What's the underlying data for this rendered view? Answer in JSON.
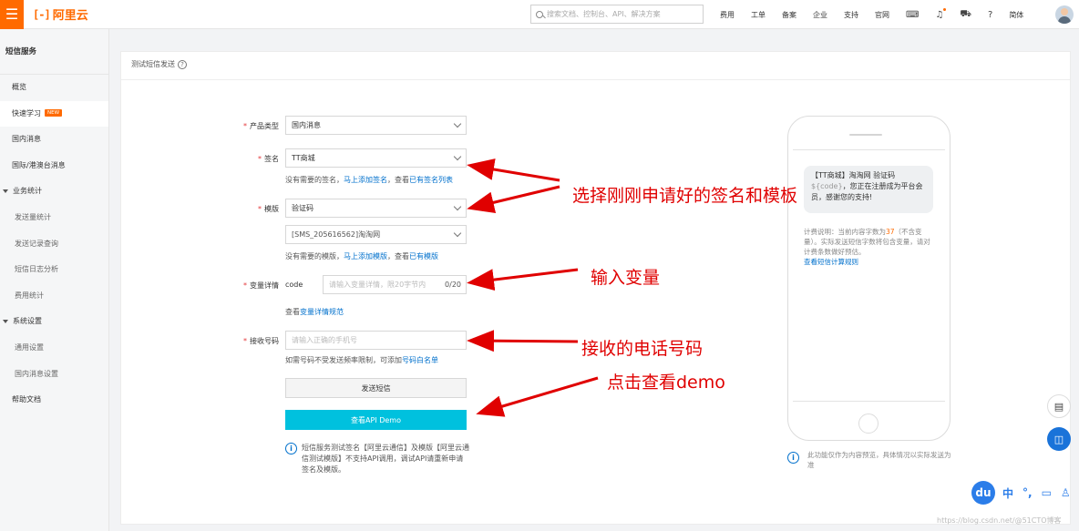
{
  "topbar": {
    "menu_icon": "hamburger-icon",
    "logo_mark": "[-]",
    "logo_text": "阿里云",
    "search_placeholder": "搜索文档、控制台、API、解决方案",
    "nav": [
      "费用",
      "工单",
      "备案",
      "企业",
      "支持",
      "官网"
    ],
    "language": "简体",
    "icons": [
      "terminal-icon",
      "bell-icon",
      "cart-icon",
      "help-icon"
    ]
  },
  "sidebar": {
    "title": "短信服务",
    "items": [
      {
        "label": "概览"
      },
      {
        "label": "快速学习",
        "badge": "NEW"
      },
      {
        "label": "国内消息"
      },
      {
        "label": "国际/港澳台消息"
      },
      {
        "label": "业务统计"
      },
      {
        "label": "发送量统计"
      },
      {
        "label": "发送记录查询"
      },
      {
        "label": "短信日志分析"
      },
      {
        "label": "费用统计"
      },
      {
        "label": "系统设置"
      },
      {
        "label": "通用设置"
      },
      {
        "label": "国内消息设置"
      },
      {
        "label": "帮助文档"
      }
    ]
  },
  "panel": {
    "title": "测试短信发送"
  },
  "form": {
    "product_type_label": "产品类型",
    "product_type_value": "国内消息",
    "signature_label": "签名",
    "signature_value": "TT商城",
    "signature_hint_pre": "没有需要的签名，",
    "signature_hint_link1": "马上添加签名",
    "signature_hint_mid": "，查看",
    "signature_hint_link2": "已有签名列表",
    "template_label": "模版",
    "template_value": "验证码",
    "template_code_value": "[SMS_205616562]淘淘网",
    "template_hint_pre": "没有需要的模版，",
    "template_hint_link1": "马上添加模版",
    "template_hint_mid": "，查看",
    "template_hint_link2": "已有模版",
    "variable_label": "变量详情",
    "variable_name": "code",
    "variable_placeholder": "请输入变量详情，限20字节内",
    "variable_count": "0/20",
    "variable_hint_pre": "查看",
    "variable_hint_link": "变量详情规范",
    "phone_label": "接收号码",
    "phone_placeholder": "请输入正确的手机号",
    "phone_hint_pre": "如需号码不受发送频率限制，可添加",
    "phone_hint_link": "号码白名单",
    "send_button": "发送短信",
    "api_demo_button": "查看API Demo",
    "notice": "短信服务测试签名【阿里云通信】及模版【阿里云通信测试模版】不支持API调用，调试API请重新申请签名及模版。"
  },
  "preview": {
    "message": "【TT商城】淘淘网 验证码",
    "message_var": "${code}",
    "message_rest": "，您正在注册成为平台会员，感谢您的支持!",
    "billing_pre": "计费说明：当前内容字数为",
    "billing_count": "37",
    "billing_post": "（不含变量）。实际发送短信字数将包含变量，请对计费条数做好预估。",
    "billing_link": "查看短信计算规则",
    "preview_note": "此功能仅作为内容预览，具体情况以实际发送为准"
  },
  "annotations": {
    "select_sig_tpl": "选择刚刚申请好的签名和模板",
    "input_variable": "输入变量",
    "phone_number": "接收的电话号码",
    "click_demo": "点击查看demo"
  },
  "ime": {
    "logo": "du",
    "label": "中"
  },
  "watermark": "https://blog.csdn.net/@51CTO博客"
}
